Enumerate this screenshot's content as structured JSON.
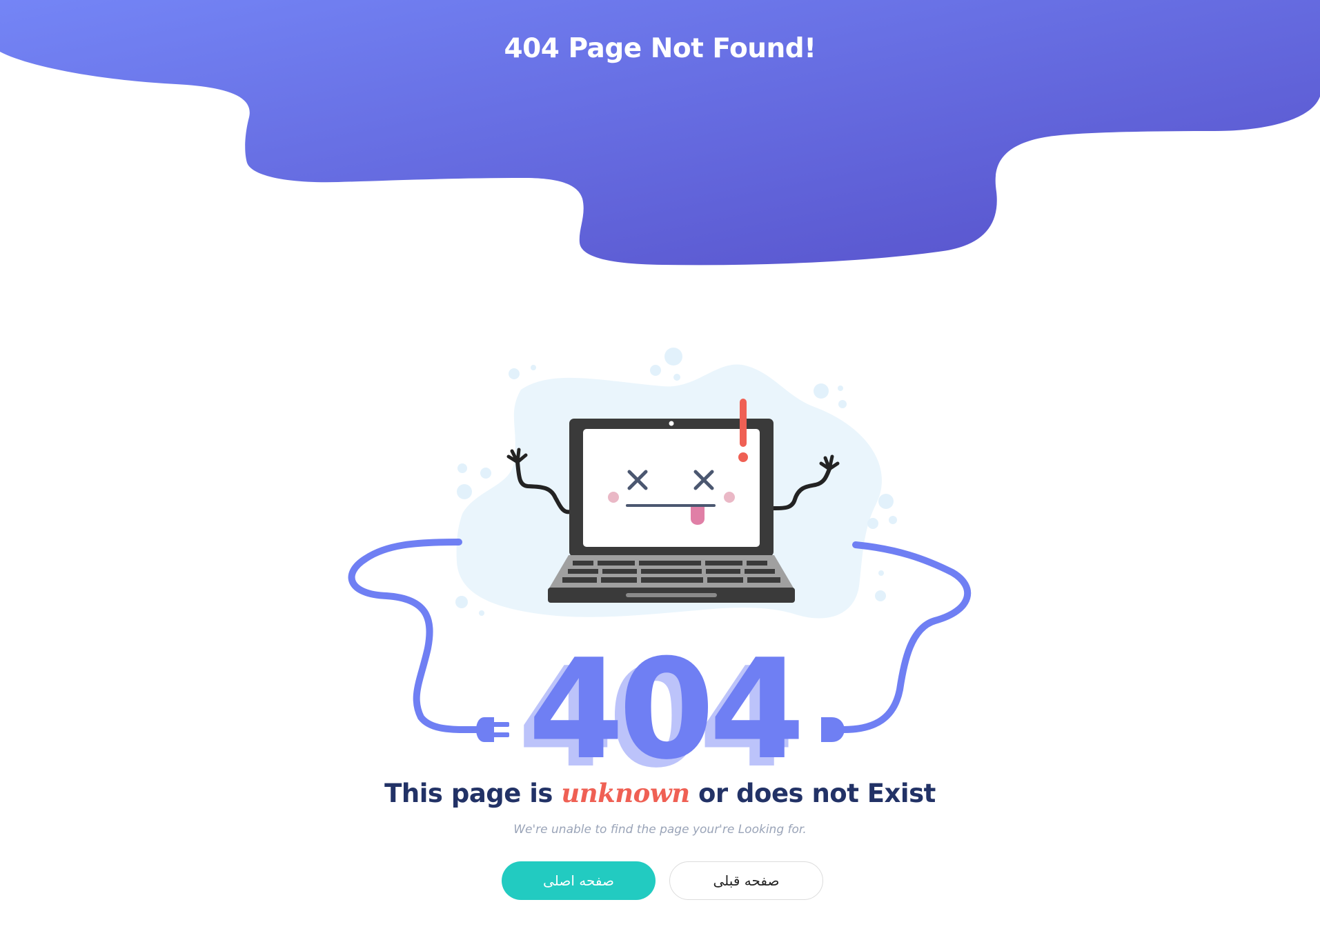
{
  "header": {
    "title": "404 Page Not Found!"
  },
  "illustration": {
    "code_text": "404",
    "exclamation_icon": "exclamation-icon",
    "face": "dizzy-face-icon",
    "plug_icons": [
      "plug-left-icon",
      "plug-right-icon"
    ]
  },
  "message": {
    "part1": "This page is ",
    "emphasis": "unknown",
    "part2": " or does not Exist",
    "subtext": "We're unable to find the page your're Looking for."
  },
  "buttons": {
    "home_label": "صفحه اصلی",
    "back_label": "صفحه قبلی"
  },
  "colors": {
    "gradient_start": "#7485f6",
    "gradient_end": "#5650c9",
    "accent_blue": "#6f7ff3",
    "accent_red": "#ef6054",
    "headline_navy": "#223266",
    "button_teal": "#22cbc1"
  }
}
